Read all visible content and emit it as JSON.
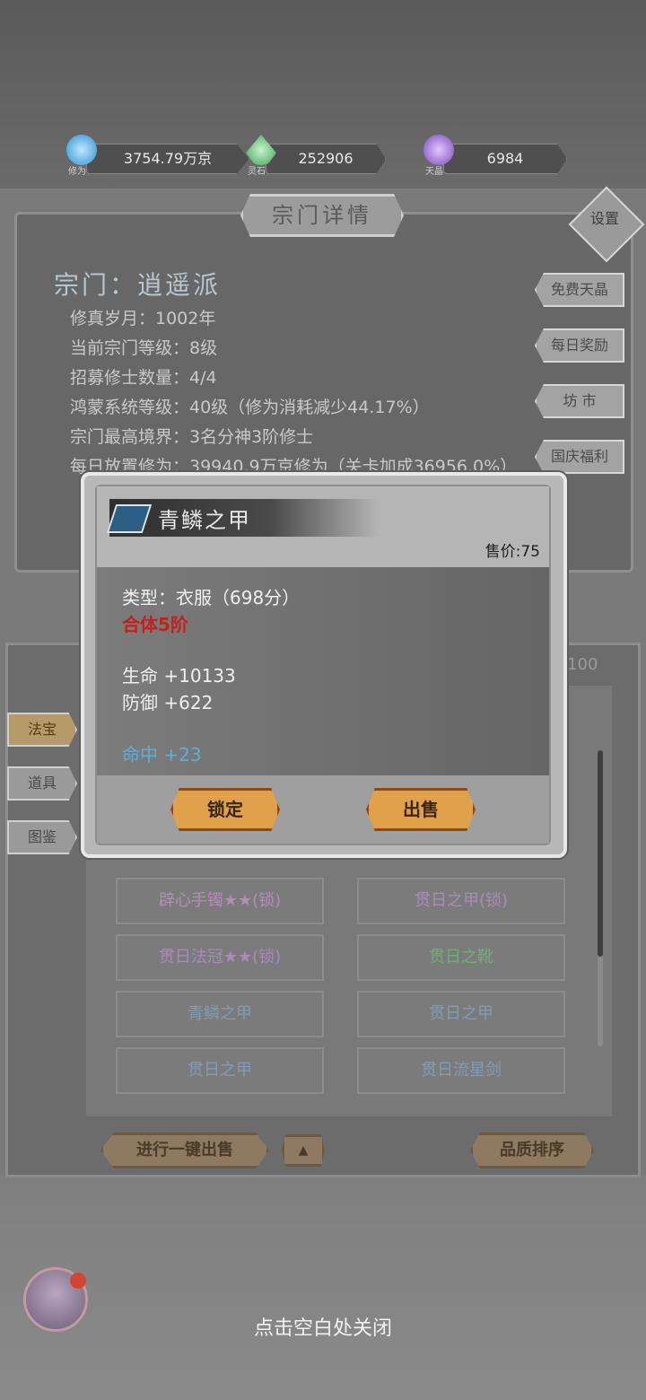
{
  "resources": [
    {
      "name": "修为",
      "value": "3754.79万京",
      "icon": "cultivation-flame-icon",
      "color": "#3ab2f0"
    },
    {
      "name": "灵石",
      "value": "252906",
      "icon": "spirit-stone-icon",
      "color": "#4fbf6a"
    },
    {
      "name": "天晶",
      "value": "6984",
      "icon": "sky-crystal-icon",
      "color": "#8a5ac8"
    }
  ],
  "sect": {
    "title": "宗门详情",
    "settings_label": "设置",
    "name": "宗门：逍遥派",
    "lines": [
      "修真岁月：1002年",
      "当前宗门等级：8级",
      "招募修士数量：4/4",
      "鸿蒙系统等级：40级（修为消耗减少44.17%）",
      "宗门最高境界：3名分神3阶修士",
      "每日放置修为：39940.9万京修为（关卡加成36956.0%）"
    ],
    "side_buttons": [
      "免费天晶",
      "每日奖励",
      "坊 市",
      "国庆福利"
    ]
  },
  "inventory": {
    "count": "/100",
    "tabs": [
      "法宝",
      "道具",
      "图鉴"
    ],
    "items": [
      {
        "label": "辟心手镯★★(锁)",
        "color": "#b58bb8"
      },
      {
        "label": "贯日之甲(锁)",
        "color": "#a98ab8"
      },
      {
        "label": "贯日法冠★★(锁)",
        "color": "#a98ab8"
      },
      {
        "label": "贯日之靴",
        "color": "#6fae77"
      },
      {
        "label": "青鳞之甲",
        "color": "#7e9cb8"
      },
      {
        "label": "贯日之甲",
        "color": "#7e9cb8"
      },
      {
        "label": "贯日之甲",
        "color": "#7e9cb8"
      },
      {
        "label": "贯日流星剑",
        "color": "#7e9cb8"
      }
    ],
    "sell_all_label": "进行一键出售",
    "up_arrow": "▲",
    "sort_label": "品质排序"
  },
  "dialog": {
    "title": "青鳞之甲",
    "price": "售价:75",
    "type_line": "类型：衣服（698分）",
    "realm": "合体5阶",
    "hp": "生命 +10133",
    "defense": "防御 +622",
    "hit": "命中 +23",
    "lock_label": "锁定",
    "sell_label": "出售"
  },
  "close_hint": "点击空白处关闭"
}
